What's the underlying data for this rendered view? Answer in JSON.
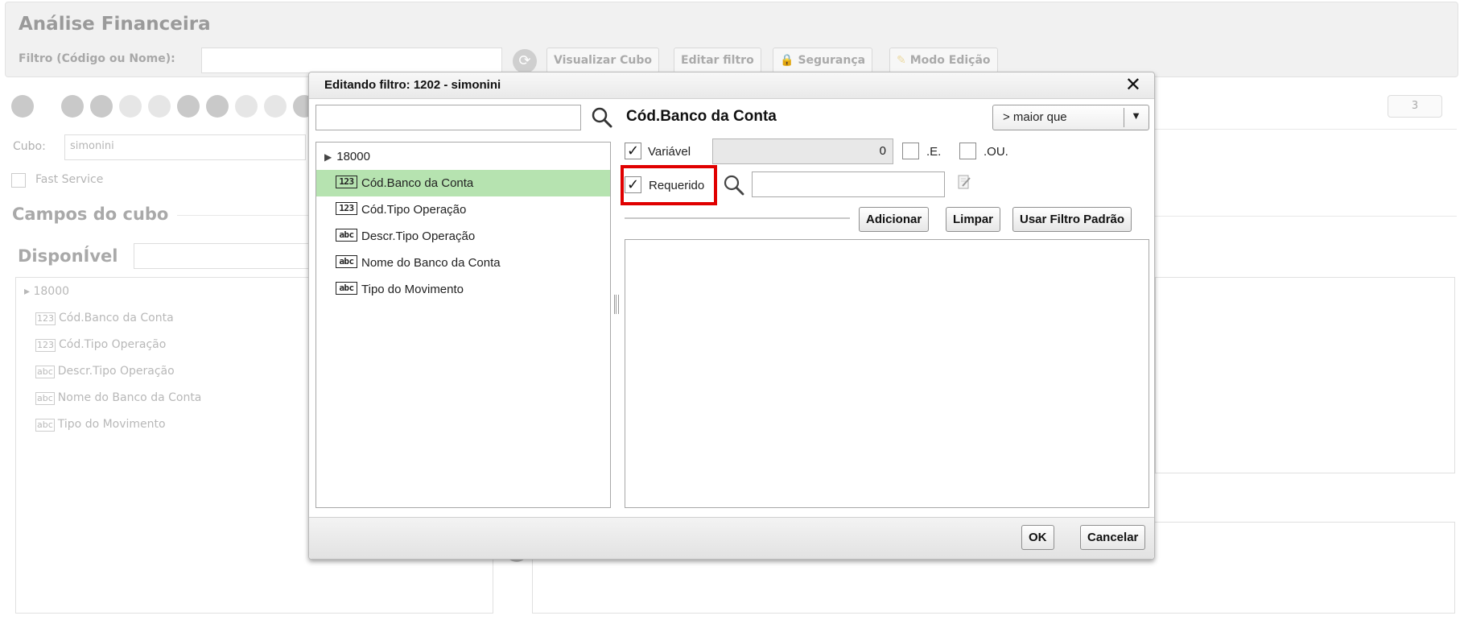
{
  "background": {
    "app_title": "Análise Financeira",
    "filter_label": "Filtro (Código ou Nome):",
    "toolbar": {
      "visualizar_cubo": "Visualizar Cubo",
      "editar_filtro": "Editar filtro",
      "seguranca": "Segurança",
      "modo_edicao": "Modo Edição"
    },
    "badge_count": "3",
    "cubo_label": "Cubo:",
    "cubo_value": "simonini",
    "fast_service_label": "Fast Service",
    "campos_title": "Campos do cubo",
    "disponivel_title": "DisponÍvel",
    "tree": {
      "root": "18000",
      "items": [
        {
          "tag": "123",
          "label": "Cód.Banco da Conta"
        },
        {
          "tag": "123",
          "label": "Cód.Tipo Operação"
        },
        {
          "tag": "abc",
          "label": "Descr.Tipo Operação"
        },
        {
          "tag": "abc",
          "label": "Nome do Banco da Conta"
        },
        {
          "tag": "abc",
          "label": "Tipo do Movimento"
        }
      ]
    }
  },
  "dialog": {
    "title": "Editando filtro: 1202 - simonini",
    "close_glyph": "✕",
    "search_placeholder": "",
    "tree": {
      "root": "18000",
      "items": [
        {
          "tag": "123",
          "label": "Cód.Banco da Conta",
          "selected": true
        },
        {
          "tag": "123",
          "label": "Cód.Tipo Operação"
        },
        {
          "tag": "abc",
          "label": "Descr.Tipo Operação"
        },
        {
          "tag": "abc",
          "label": "Nome do Banco da Conta"
        },
        {
          "tag": "abc",
          "label": "Tipo do Movimento"
        }
      ]
    },
    "field_title": "Cód.Banco da Conta",
    "operator": "> maior que",
    "variavel": {
      "label": "Variável",
      "checked": true,
      "value": "0"
    },
    "and_label": ".E.",
    "or_label": ".OU.",
    "requerido": {
      "label": "Requerido",
      "checked": true
    },
    "check_glyph": "✓",
    "buttons": {
      "adicionar": "Adicionar",
      "limpar": "Limpar",
      "usar_filtro_padrao": "Usar Filtro Padrão",
      "ok": "OK",
      "cancelar": "Cancelar"
    },
    "colors": {
      "selected_row": "#b6e3b0",
      "highlight": "#e00000"
    }
  }
}
